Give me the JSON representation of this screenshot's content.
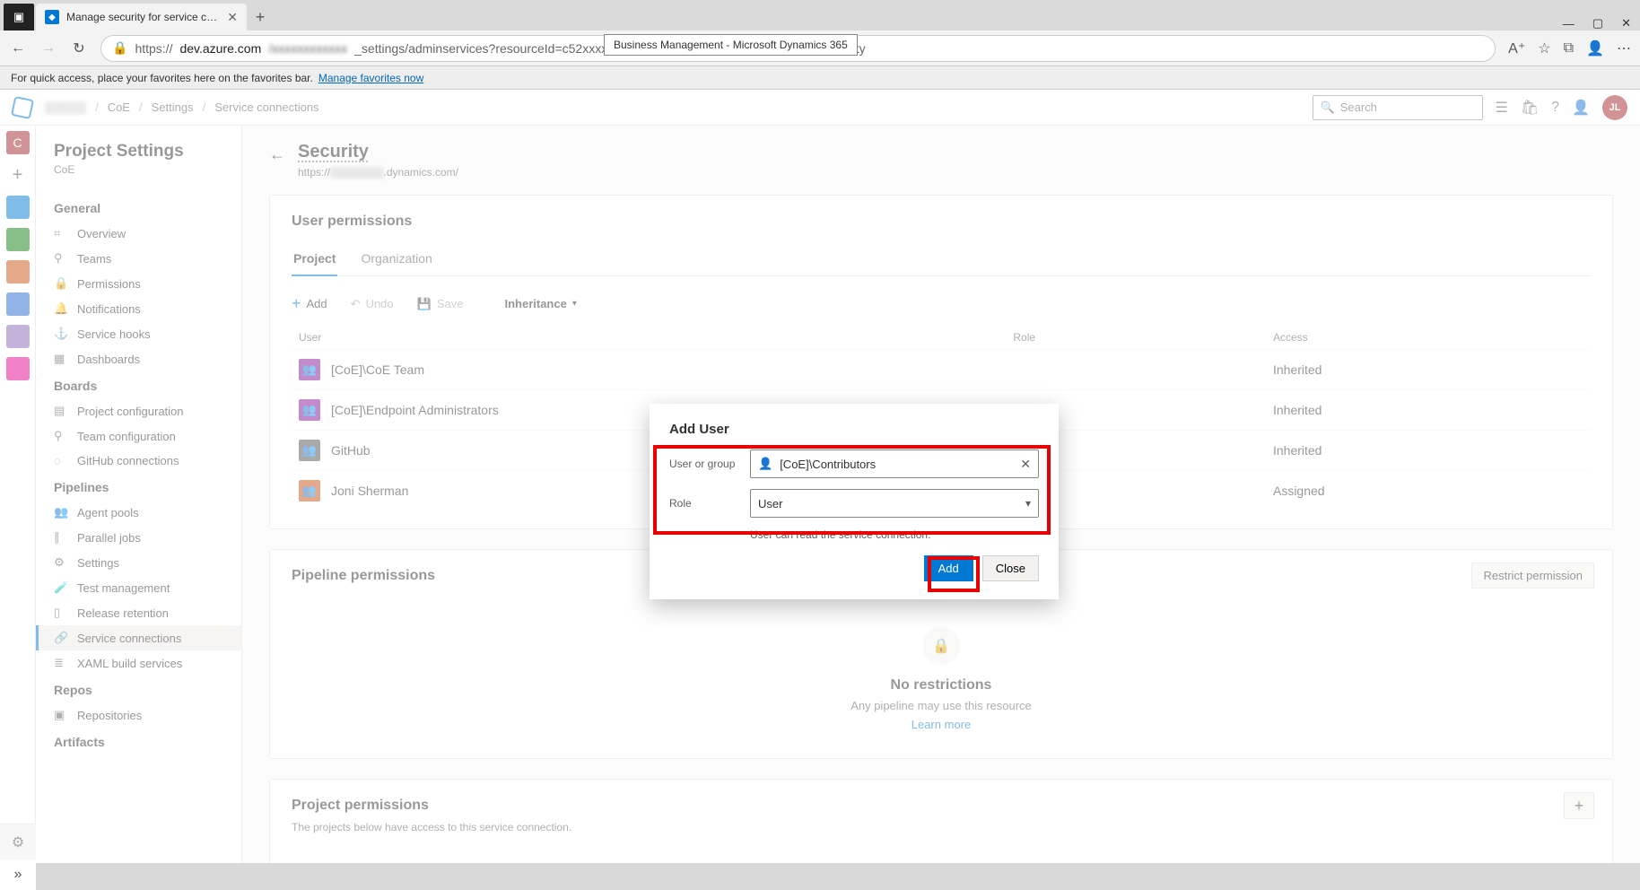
{
  "window": {
    "min": "—",
    "max": "▢",
    "close": "✕"
  },
  "browser": {
    "tab_title": "Manage security for service conn",
    "new_tab": "+",
    "tooltip": "Business Management - Microsoft Dynamics 365",
    "addr_prefix": "https://",
    "addr_host": "dev.azure.com",
    "addr_path_blur": "/xxxxxxxxxxxx",
    "addr_path": "_settings/adminservices?resourceId=c52xxxxx-xxxx-xxxx-xxxx-xxxxxxxxxxxx&view=security",
    "fav_text": "For quick access, place your favorites here on the favorites bar.",
    "fav_link": "Manage favorites now"
  },
  "header": {
    "org_blur": "▒▒▒▒▒",
    "crumb1": "CoE",
    "crumb2": "Settings",
    "crumb3": "Service connections",
    "search_placeholder": "Search",
    "avatar": "JL"
  },
  "vnav": [
    {
      "color": "#a4262c",
      "txt": "C"
    },
    {
      "color": "transparent",
      "txt": "+",
      "add": true
    },
    {
      "color": "#0078d4",
      "txt": ""
    },
    {
      "color": "#107c10",
      "txt": ""
    },
    {
      "color": "#ca5010",
      "txt": ""
    },
    {
      "color": "#2266cc",
      "txt": ""
    },
    {
      "color": "#8764b8",
      "txt": ""
    },
    {
      "color": "#e3008c",
      "txt": ""
    }
  ],
  "left": {
    "title": "Project Settings",
    "subtitle": "CoE",
    "sections": [
      {
        "title": "General",
        "items": [
          {
            "ic": "⌗",
            "label": "Overview"
          },
          {
            "ic": "⚲",
            "label": "Teams"
          },
          {
            "ic": "🔒",
            "label": "Permissions"
          },
          {
            "ic": "🔔",
            "label": "Notifications"
          },
          {
            "ic": "⚓",
            "label": "Service hooks"
          },
          {
            "ic": "▦",
            "label": "Dashboards"
          }
        ]
      },
      {
        "title": "Boards",
        "items": [
          {
            "ic": "▤",
            "label": "Project configuration"
          },
          {
            "ic": "⚲",
            "label": "Team configuration"
          },
          {
            "ic": "◌",
            "label": "GitHub connections"
          }
        ]
      },
      {
        "title": "Pipelines",
        "items": [
          {
            "ic": "👥",
            "label": "Agent pools"
          },
          {
            "ic": "∥",
            "label": "Parallel jobs"
          },
          {
            "ic": "⚙",
            "label": "Settings"
          },
          {
            "ic": "🧪",
            "label": "Test management"
          },
          {
            "ic": "▯",
            "label": "Release retention"
          },
          {
            "ic": "🔗",
            "label": "Service connections",
            "active": true
          },
          {
            "ic": "≣",
            "label": "XAML build services"
          }
        ]
      },
      {
        "title": "Repos",
        "items": [
          {
            "ic": "▣",
            "label": "Repositories"
          }
        ]
      },
      {
        "title": "Artifacts",
        "items": []
      }
    ]
  },
  "page": {
    "title": "Security",
    "subtitle_prefix": "https://",
    "subtitle_blur": "▒▒▒▒▒▒▒",
    "subtitle_suffix": ".dynamics.com/"
  },
  "perm_card": {
    "title": "User permissions",
    "tabs": {
      "t1": "Project",
      "t2": "Organization"
    },
    "toolbar": {
      "add": "Add",
      "undo": "Undo",
      "save": "Save",
      "inherit": "Inheritance"
    },
    "cols": {
      "user": "User",
      "role": "Role",
      "access": "Access"
    },
    "rows": [
      {
        "avbg": "#881798",
        "name": "[CoE]\\CoE Team",
        "access": "Inherited"
      },
      {
        "avbg": "#881798",
        "name": "[CoE]\\Endpoint Administrators",
        "access": "Inherited"
      },
      {
        "avbg": "#555",
        "name": "GitHub",
        "access": "Inherited"
      },
      {
        "avbg": "#ca5010",
        "name": "Joni Sherman",
        "access": "Assigned"
      }
    ]
  },
  "pipeline_card": {
    "title": "Pipeline permissions",
    "restrict": "Restrict permission",
    "h": "No restrictions",
    "sub": "Any pipeline may use this resource",
    "link": "Learn more"
  },
  "proj_card": {
    "title": "Project permissions",
    "sub": "The projects below have access to this service connection."
  },
  "dialog": {
    "title": "Add User",
    "label_user": "User or group",
    "user_value": "[CoE]\\Contributors",
    "label_role": "Role",
    "role_value": "User",
    "help": "User can read the service connection.",
    "btn_add": "Add",
    "btn_close": "Close"
  }
}
